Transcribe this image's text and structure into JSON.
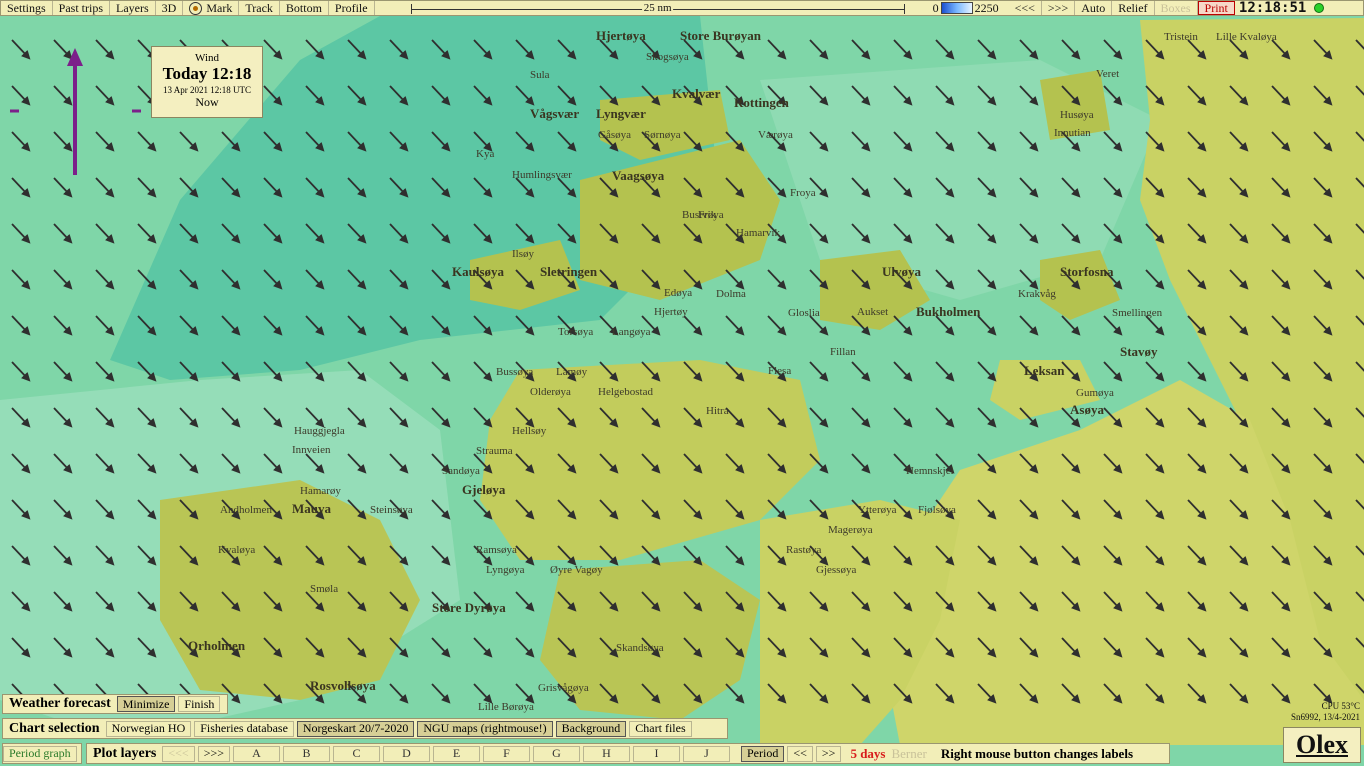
{
  "toolbar": {
    "settings": "Settings",
    "past_trips": "Past trips",
    "layers": "Layers",
    "view3d": "3D",
    "mark": "Mark",
    "track": "Track",
    "bottom": "Bottom",
    "profile": "Profile",
    "scale_label": "25 nm",
    "depth_min": "0",
    "depth_max": "2250",
    "nav_back": "<<<",
    "nav_fwd": ">>>",
    "auto": "Auto",
    "relief": "Relief",
    "boxes": "Boxes",
    "print": "Print",
    "clock": "12:18:51"
  },
  "wind_box": {
    "title": "Wind",
    "time": "Today 12:18",
    "date": "13 Apr 2021 12:18 UTC",
    "now": "Now"
  },
  "weather_panel": {
    "title": "Weather forecast",
    "minimize": "Minimize",
    "finish": "Finish"
  },
  "chart_panel": {
    "title": "Chart selection",
    "items": [
      "Norwegian HO",
      "Fisheries database",
      "Norgeskart 20/7-2020",
      "NGU maps (rightmouse!)",
      "Background",
      "Chart files"
    ]
  },
  "bottom_bar": {
    "period_graph": "Period graph",
    "plot_layers": "Plot layers",
    "prev": "<<<",
    "next": ">>>",
    "letters": [
      "A",
      "B",
      "C",
      "D",
      "E",
      "F",
      "G",
      "H",
      "I",
      "J"
    ],
    "period": "Period",
    "p_back": "<<",
    "p_fwd": ">>",
    "days": "5 days",
    "berner": "Berner",
    "hint": "Right mouse button changes labels"
  },
  "status": {
    "cpu": "CPU 53°C",
    "serial": "Sn6992, 13/4-2021"
  },
  "logo": "Olex",
  "places": [
    "Hjertøya",
    "Store Burøyan",
    "Sula",
    "Skogsøya",
    "Kvalvær",
    "Rottingen",
    "Tristein",
    "Lille Kvaløya",
    "Veret",
    "Vågsvær",
    "Lyngvær",
    "Gåsøya",
    "Sørnøya",
    "Værøya",
    "Husøya",
    "Kya",
    "Humlingsvær",
    "Vaagsøya",
    "Froya",
    "Innutian",
    "Kaulsøya",
    "Sletringen",
    "Ilsøy",
    "Bustvik",
    "Frøya",
    "Hamarvik",
    "Storfosna",
    "Edøya",
    "Dolma",
    "Ulvøya",
    "Krakvåg",
    "Hjertøy",
    "Gloslia",
    "Aukset",
    "Bukholmen",
    "Smellingen",
    "Torsøya",
    "Langøya",
    "Stavøy",
    "Bussøya",
    "Lamøy",
    "Fillan",
    "Leksan",
    "Flesa",
    "Olderøya",
    "Helgebostad",
    "Hitra",
    "Gumøya",
    "Asøya",
    "Hellsøy",
    "Strauma",
    "Hauggjegla",
    "Innveien",
    "Hemnskjel",
    "Sandøya",
    "Gjeløya",
    "Hamarøy",
    "Ytterøya",
    "Fjølsøya",
    "Andholmen",
    "Mauva",
    "Steinsøya",
    "Ramsøya",
    "Lyngøya",
    "Øyre Vagøy",
    "Magerøya",
    "Rastøya",
    "Kvaløya",
    "Smøla",
    "Store Dyrøya",
    "Gjessøya",
    "Orholmen",
    "Skandsøya",
    "Rosvollsøya",
    "Grisvågøya",
    "Lille Børøya"
  ],
  "colors": {
    "sea": "#7fd6a8",
    "sea_light": "#a7e3c4",
    "sea_deep": "#5cc7a4",
    "land": "#c9d264",
    "land_dark": "#b4c24f",
    "toolbar_bg": "#f2eeb8",
    "accent_purple": "#7c1f8a",
    "alert_red": "#d81b1b"
  },
  "icons": {
    "compass": "compass-icon",
    "gps_status": "gps-status-icon",
    "wind_direction": "wind-direction-arrow-icon"
  }
}
